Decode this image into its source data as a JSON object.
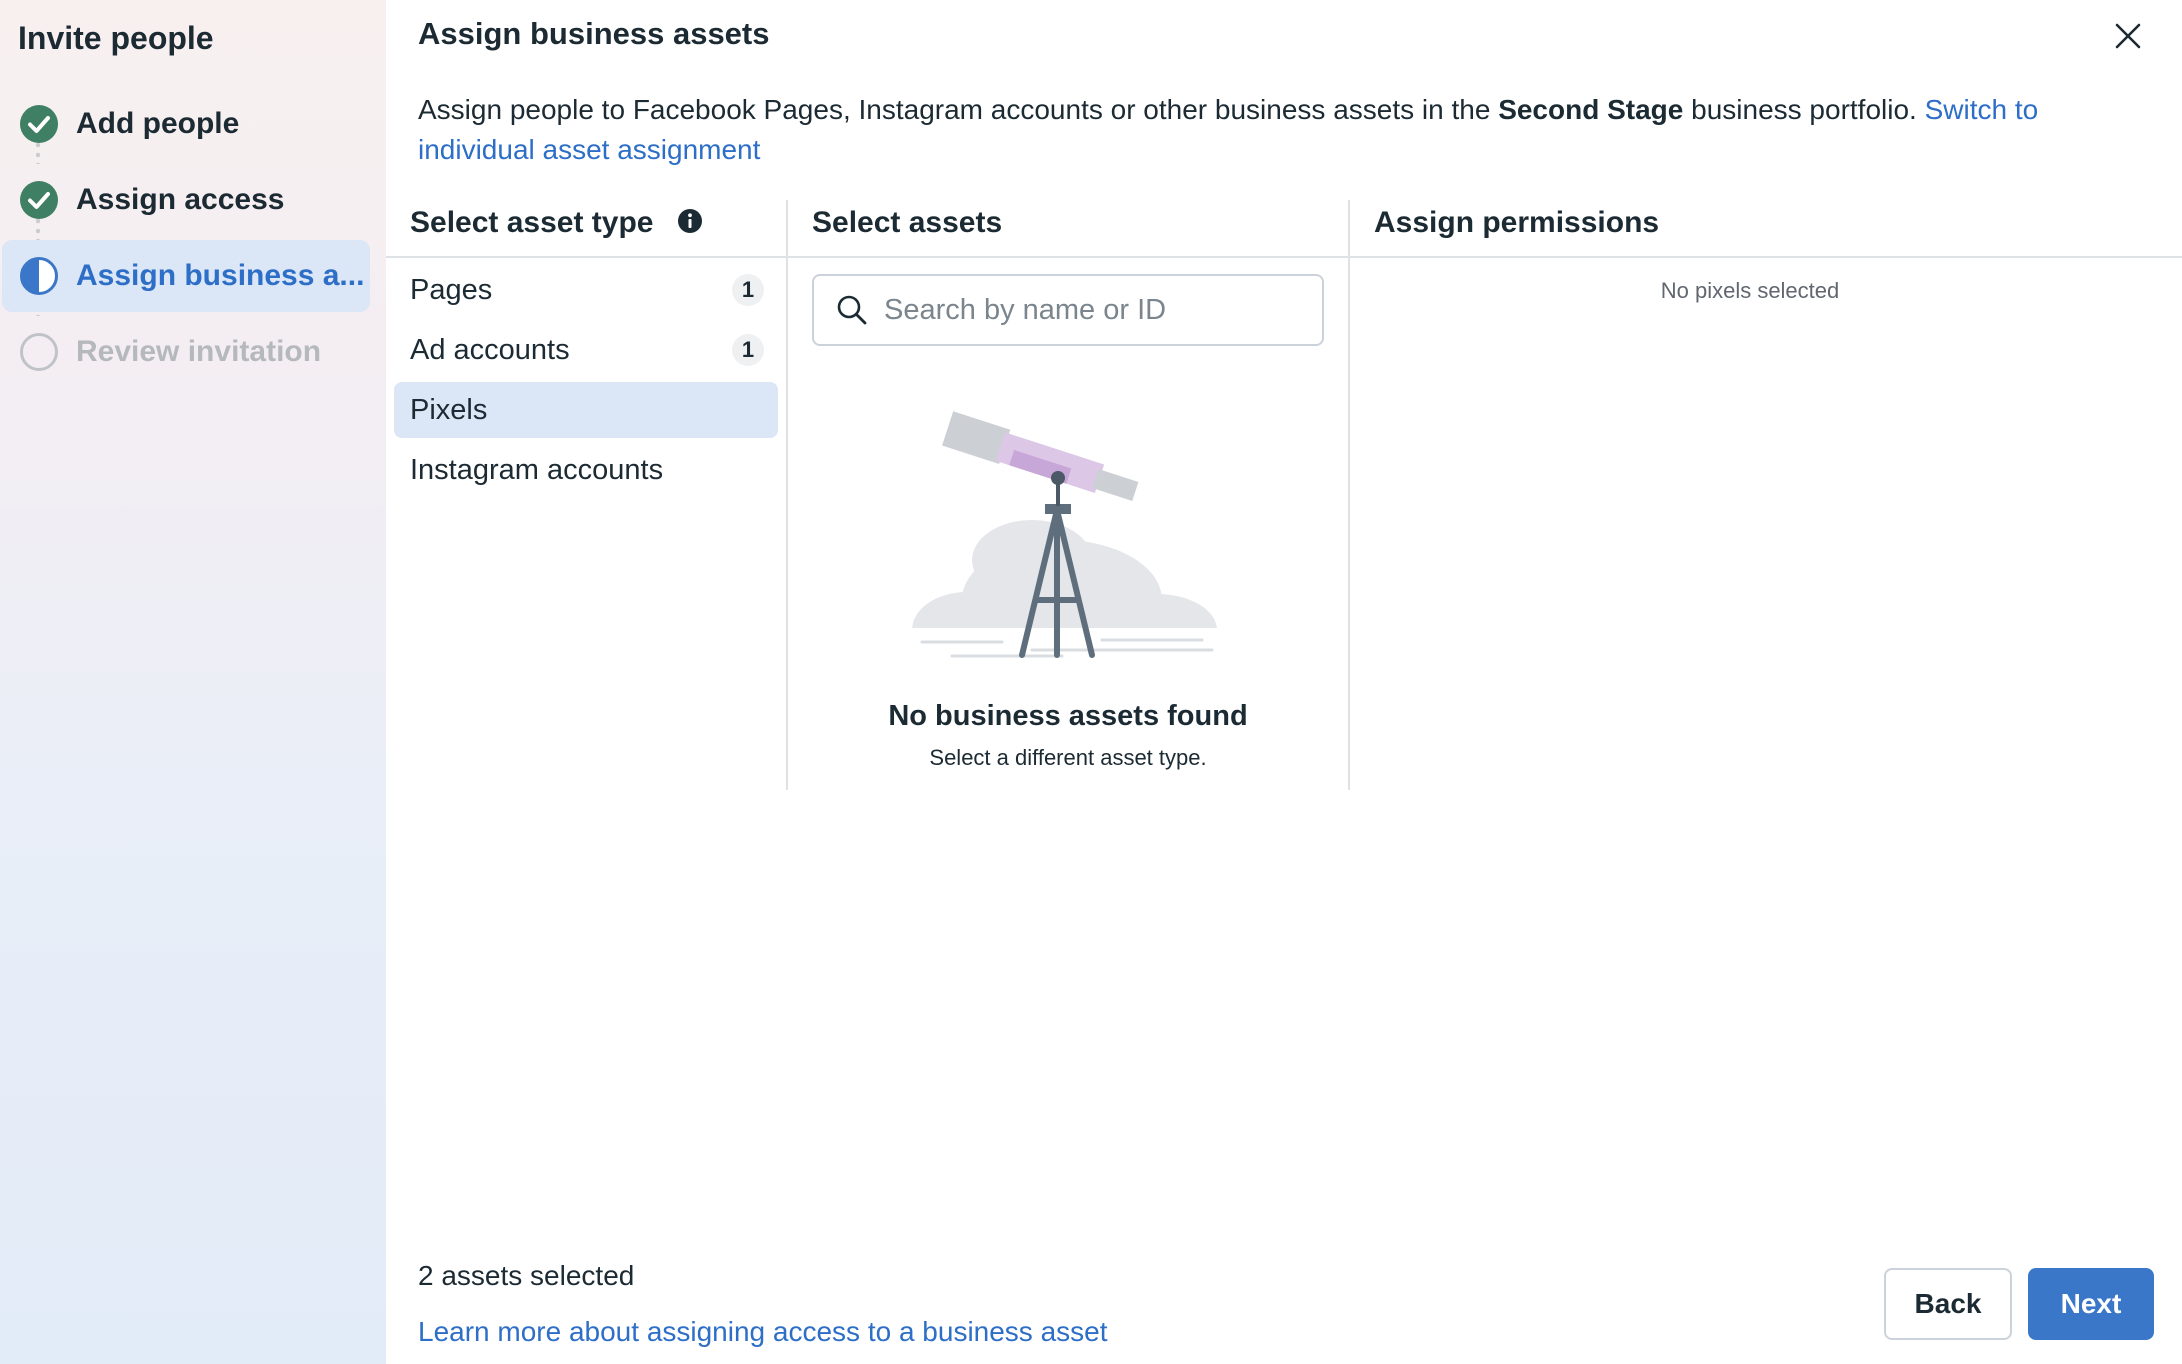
{
  "sidebar": {
    "title": "Invite people",
    "steps": [
      {
        "label": "Add people",
        "status": "complete"
      },
      {
        "label": "Assign access",
        "status": "complete"
      },
      {
        "label": "Assign business a...",
        "status": "active"
      },
      {
        "label": "Review invitation",
        "status": "pending"
      }
    ]
  },
  "header": {
    "title": "Assign business assets"
  },
  "description": {
    "text_before": "Assign people to Facebook Pages, Instagram accounts or other business assets in the ",
    "portfolio_name": "Second Stage",
    "text_after": " business portfolio. ",
    "link": "Switch to individual asset assignment"
  },
  "columns": {
    "asset_type_title": "Select asset type",
    "assets_title": "Select assets",
    "permissions_title": "Assign permissions"
  },
  "asset_types": [
    {
      "label": "Pages",
      "count": "1"
    },
    {
      "label": "Ad accounts",
      "count": "1"
    },
    {
      "label": "Pixels",
      "count": ""
    },
    {
      "label": "Instagram accounts",
      "count": ""
    }
  ],
  "selected_asset_type": "Pixels",
  "search": {
    "placeholder": "Search by name or ID"
  },
  "empty_state": {
    "title": "No business assets found",
    "subtitle": "Select a different asset type."
  },
  "permissions": {
    "empty_text": "No pixels selected"
  },
  "footer": {
    "assets_selected": "2 assets selected",
    "learn_more": "Learn more about assigning access to a business asset",
    "back_label": "Back",
    "next_label": "Next"
  },
  "colors": {
    "accent": "#2d6ec7",
    "success": "#3f7f63",
    "primary_button": "#3a77c9"
  },
  "icons": {
    "complete": "checkmark-circle-icon",
    "active": "half-circle-icon",
    "pending": "empty-circle-icon",
    "info": "info-icon",
    "search": "search-icon",
    "close": "close-icon"
  }
}
